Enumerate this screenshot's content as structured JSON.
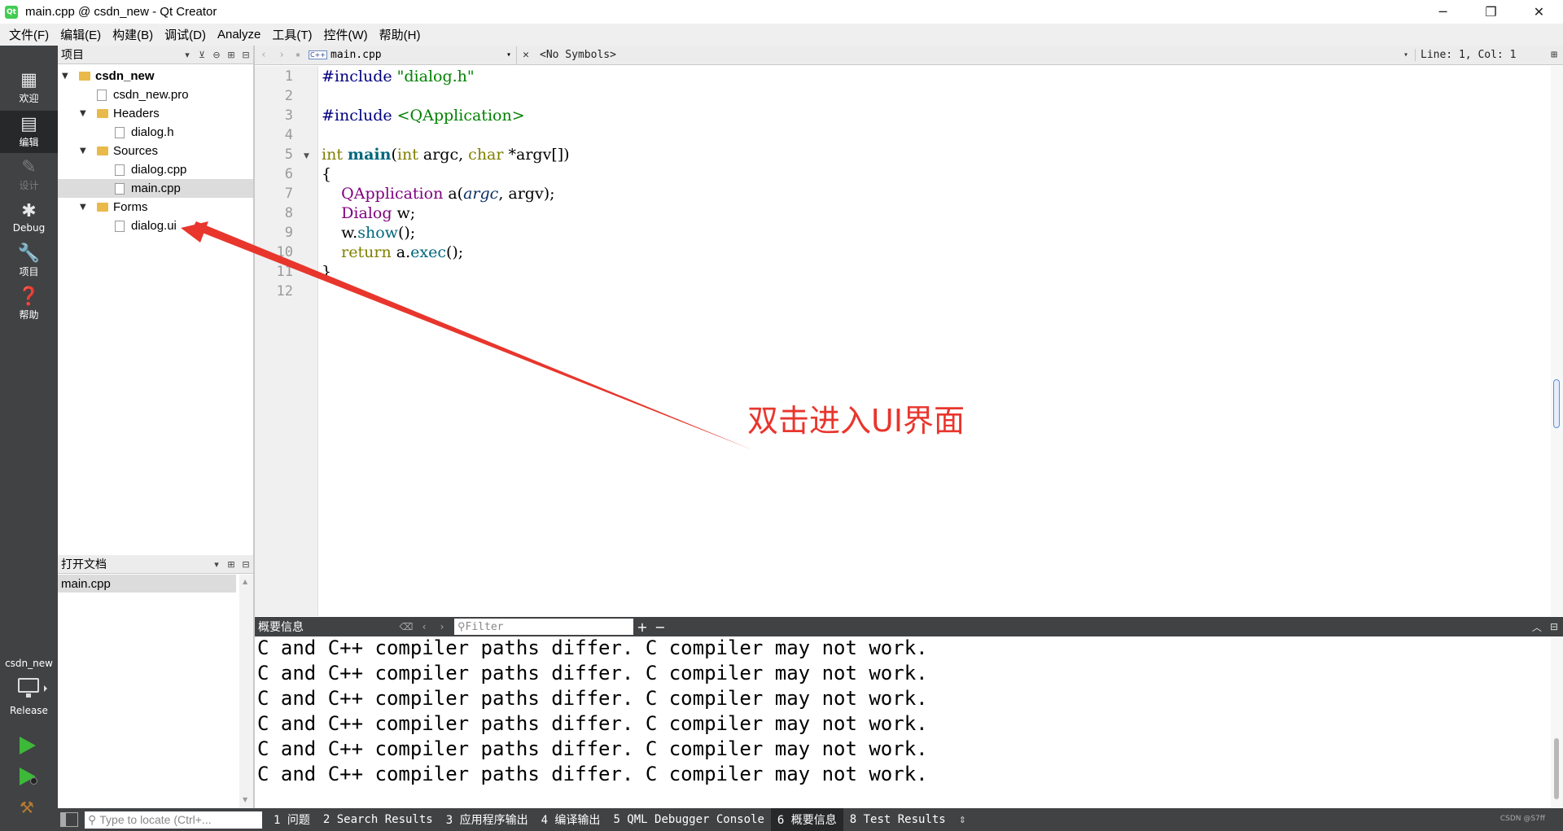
{
  "window": {
    "title": "main.cpp @ csdn_new - Qt Creator",
    "controls": {
      "minimize": "─",
      "restore": "❐",
      "close": "✕"
    }
  },
  "menu": [
    "文件(F)",
    "编辑(E)",
    "构建(B)",
    "调试(D)",
    "Analyze",
    "工具(T)",
    "控件(W)",
    "帮助(H)"
  ],
  "modes": {
    "welcome": "欢迎",
    "edit": "编辑",
    "design": "设计",
    "debug": "Debug",
    "projects": "项目",
    "help": "帮助"
  },
  "kit": {
    "project": "csdn_new",
    "build": "Release"
  },
  "project_panel": {
    "title": "项目",
    "tree": {
      "root": "csdn_new",
      "pro_file": "csdn_new.pro",
      "headers": "Headers",
      "dialog_h": "dialog.h",
      "sources": "Sources",
      "dialog_cpp": "dialog.cpp",
      "main_cpp": "main.cpp",
      "forms": "Forms",
      "dialog_ui": "dialog.ui"
    }
  },
  "open_docs": {
    "title": "打开文档",
    "items": [
      "main.cpp"
    ]
  },
  "editor": {
    "file": "main.cpp",
    "symbols": "<No Symbols>",
    "position": "Line: 1, Col: 1",
    "line_numbers": [
      "1",
      "2",
      "3",
      "4",
      "5",
      "6",
      "7",
      "8",
      "9",
      "10",
      "11",
      "12"
    ],
    "code": {
      "l1_pp": "#include ",
      "l1_str": "\"dialog.h\"",
      "l3_pp": "#include ",
      "l3_str": "<QApplication>",
      "l5_kw1": "int",
      "l5_main": "main",
      "l5_open": "(",
      "l5_kw2": "int",
      "l5_argc": " argc, ",
      "l5_kw3": "char",
      "l5_argv": " *argv[])",
      "l6": "{",
      "l7_cls": "QApplication",
      "l7_a": " a(",
      "l7_argc": "argc",
      "l7_rest": ", argv);",
      "l8_cls": "Dialog",
      "l8_rest": " w;",
      "l9_w": "w.",
      "l9_fn": "show",
      "l9_rest": "();",
      "l10_kw": "return",
      "l10_a": " a.",
      "l10_fn": "exec",
      "l10_rest": "();",
      "l11": "}"
    }
  },
  "annotation": {
    "text": "双击进入UI界面",
    "color": "#e8362d"
  },
  "output_pane": {
    "title": "概要信息",
    "filter_placeholder": "Filter",
    "lines": [
      "C and C++ compiler paths differ. C compiler may not work.",
      "C and C++ compiler paths differ. C compiler may not work.",
      "C and C++ compiler paths differ. C compiler may not work.",
      "C and C++ compiler paths differ. C compiler may not work.",
      "C and C++ compiler paths differ. C compiler may not work.",
      "C and C++ compiler paths differ. C compiler may not work."
    ]
  },
  "statusbar": {
    "locate_placeholder": "Type to locate (Ctrl+...",
    "tabs": [
      "1 问题",
      "2 Search Results",
      "3 应用程序输出",
      "4 编译输出",
      "5 QML Debugger Console",
      "6 概要信息",
      "8 Test Results"
    ],
    "watermark": "CSDN @S7ff"
  }
}
